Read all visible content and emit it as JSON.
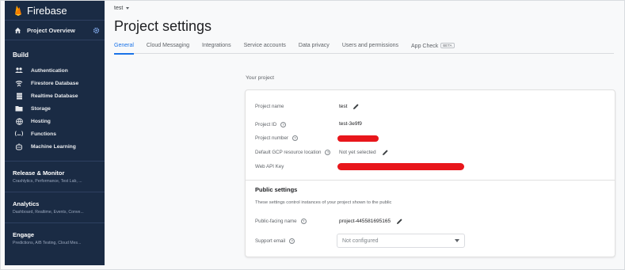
{
  "app": {
    "brand": "Firebase"
  },
  "sidebar": {
    "overview_label": "Project Overview",
    "build_label": "Build",
    "items": [
      {
        "label": "Authentication",
        "icon": "users-icon"
      },
      {
        "label": "Firestore Database",
        "icon": "wifi-database-icon"
      },
      {
        "label": "Realtime Database",
        "icon": "database-icon"
      },
      {
        "label": "Storage",
        "icon": "folder-icon"
      },
      {
        "label": "Hosting",
        "icon": "globe-icon"
      },
      {
        "label": "Functions",
        "icon": "braces-icon"
      },
      {
        "label": "Machine Learning",
        "icon": "robot-icon"
      }
    ],
    "groups": [
      {
        "title": "Release & Monitor",
        "subtitle": "Crashlytics, Performance, Test Lab, ..."
      },
      {
        "title": "Analytics",
        "subtitle": "Dashboard, Realtime, Events, Conve..."
      },
      {
        "title": "Engage",
        "subtitle": "Predictions, A/B Testing, Cloud Mes..."
      }
    ]
  },
  "header": {
    "project_selector": "test",
    "title": "Project settings",
    "tabs": [
      {
        "label": "General",
        "active": true
      },
      {
        "label": "Cloud Messaging"
      },
      {
        "label": "Integrations"
      },
      {
        "label": "Service accounts"
      },
      {
        "label": "Data privacy"
      },
      {
        "label": "Users and permissions"
      },
      {
        "label": "App Check",
        "badge": "BETA"
      }
    ]
  },
  "your_project": {
    "section_label": "Your project",
    "project_name_label": "Project name",
    "project_name_value": "test",
    "project_id_label": "Project ID",
    "project_id_value": "test-3e9f9",
    "project_number_label": "Project number",
    "gcp_location_label": "Default GCP resource location",
    "gcp_location_value": "Not yet selected",
    "web_api_key_label": "Web API Key"
  },
  "public_settings": {
    "title": "Public settings",
    "description": "These settings control instances of your project shown to the public",
    "public_name_label": "Public-facing name",
    "public_name_value": "project-445581695165",
    "support_email_label": "Support email",
    "support_email_value": "Not configured"
  },
  "colors": {
    "sidebar_bg": "#1a2b44",
    "accent": "#1a73e8",
    "redaction": "#e8161b"
  }
}
